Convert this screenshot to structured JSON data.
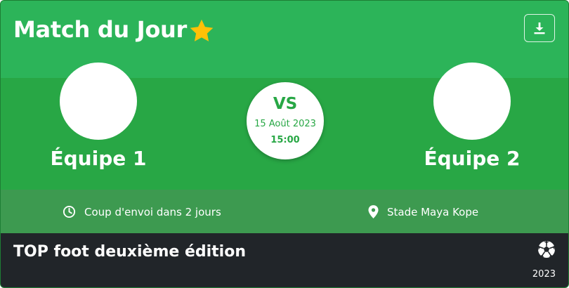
{
  "header": {
    "title": "Match du Jour",
    "star_icon": "star-icon",
    "download_icon": "download-icon"
  },
  "match": {
    "team1": "Équipe 1",
    "team2": "Équipe 2",
    "vs": "VS",
    "date": "15 Août 2023",
    "time": "15:00"
  },
  "info": {
    "kickoff": "Coup d'envoi dans 2 jours",
    "stadium": "Stade Maya Kope"
  },
  "footer": {
    "title": "TOP foot deuxième édition",
    "year": "2023",
    "ball_icon": "football-icon"
  },
  "colors": {
    "header_green": "#2cb459",
    "main_green": "#28a745",
    "info_green": "#3d9a50",
    "footer_dark": "#212529",
    "star": "#ffc107"
  }
}
